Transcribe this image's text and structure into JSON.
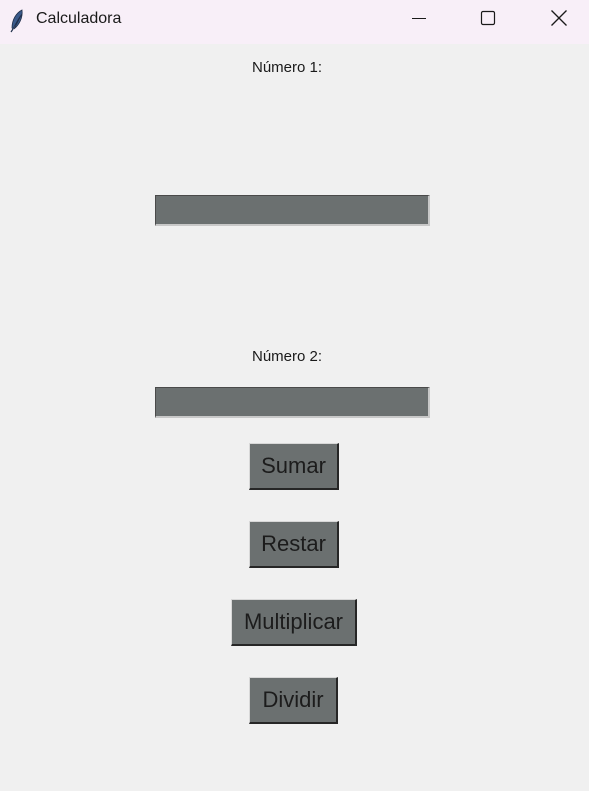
{
  "window": {
    "title": "Calculadora",
    "icon": "feather-icon",
    "controls": [
      "minimize-icon",
      "maximize-icon",
      "close-icon"
    ]
  },
  "form": {
    "label1": "Número 1:",
    "input1_value": "",
    "label2": "Número 2:",
    "input2_value": ""
  },
  "buttons": {
    "sumar": "Sumar",
    "restar": "Restar",
    "multiplicar": "Multiplicar",
    "dividir": "Dividir"
  },
  "colors": {
    "background": "#f0f0f0",
    "titlebar": "#f8eff8",
    "widget_fill": "#6b7070"
  }
}
